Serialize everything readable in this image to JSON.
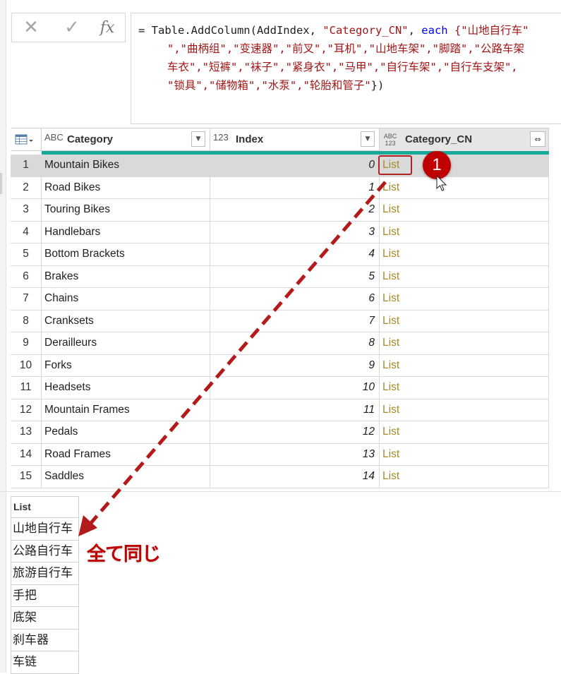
{
  "formula_bar": {
    "cancel_icon": "✕",
    "commit_icon": "✓",
    "fx_label": "fx",
    "line1_prefix": "= Table.AddColumn(AddIndex, ",
    "line1_string": "\"Category_CN\"",
    "line1_mid": ", ",
    "line1_keyword": "each",
    "line1_rest": " {\"山地自行车\"",
    "line2": "\",\"曲柄组\",\"变速器\",\"前叉\",\"耳机\",\"山地车架\",\"脚踏\",\"公路车架",
    "line3": "车衣\",\"短裤\",\"袜子\",\"紧身衣\",\"马甲\",\"自行车架\",\"自行车支架\",",
    "line4_string": "\"锁具\",\"储物箱\",\"水泵\",\"轮胎和管子\"",
    "line4_end": "})"
  },
  "grid": {
    "columns": [
      {
        "type": "ABC",
        "label": "Category"
      },
      {
        "type": "123",
        "label": "Index"
      },
      {
        "type": "ABC 123",
        "label": "Category_CN"
      }
    ],
    "rows": [
      {
        "n": "1",
        "category": "Mountain Bikes",
        "index": "0",
        "value": "List"
      },
      {
        "n": "2",
        "category": "Road Bikes",
        "index": "1",
        "value": "List"
      },
      {
        "n": "3",
        "category": "Touring Bikes",
        "index": "2",
        "value": "List"
      },
      {
        "n": "4",
        "category": "Handlebars",
        "index": "3",
        "value": "List"
      },
      {
        "n": "5",
        "category": "Bottom Brackets",
        "index": "4",
        "value": "List"
      },
      {
        "n": "6",
        "category": "Brakes",
        "index": "5",
        "value": "List"
      },
      {
        "n": "7",
        "category": "Chains",
        "index": "6",
        "value": "List"
      },
      {
        "n": "8",
        "category": "Cranksets",
        "index": "7",
        "value": "List"
      },
      {
        "n": "9",
        "category": "Derailleurs",
        "index": "8",
        "value": "List"
      },
      {
        "n": "10",
        "category": "Forks",
        "index": "9",
        "value": "List"
      },
      {
        "n": "11",
        "category": "Headsets",
        "index": "10",
        "value": "List"
      },
      {
        "n": "12",
        "category": "Mountain Frames",
        "index": "11",
        "value": "List"
      },
      {
        "n": "13",
        "category": "Pedals",
        "index": "12",
        "value": "List"
      },
      {
        "n": "14",
        "category": "Road Frames",
        "index": "13",
        "value": "List"
      },
      {
        "n": "15",
        "category": "Saddles",
        "index": "14",
        "value": "List"
      }
    ]
  },
  "callout": {
    "number": "1"
  },
  "preview": {
    "header": "List",
    "items": [
      "山地自行车",
      "公路自行车",
      "旅游自行车",
      "手把",
      "底架",
      "刹车器",
      "车链"
    ]
  },
  "annotation": "全て同じ",
  "colors": {
    "accent": "#17a99a",
    "highlight": "#c00000",
    "list_text": "#a88a2a"
  }
}
